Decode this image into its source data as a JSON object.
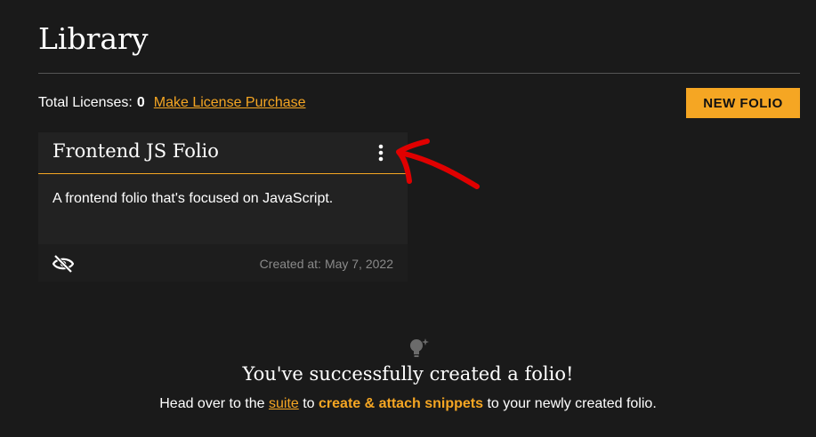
{
  "page": {
    "title": "Library"
  },
  "licenses": {
    "label": "Total Licenses:",
    "count": "0",
    "purchase_link": "Make License Purchase"
  },
  "toolbar": {
    "new_folio_label": "NEW FOLIO"
  },
  "folio_card": {
    "title": "Frontend JS Folio",
    "description": "A frontend folio that's focused on JavaScript.",
    "created_label": "Created at:",
    "created_date": "May 7, 2022",
    "visibility_icon": "eye-off-icon",
    "menu_icon": "kebab-menu-icon"
  },
  "success": {
    "title": "You've successfully created a folio!",
    "line_prefix": "Head over to the",
    "suite_link": "suite",
    "line_mid": "to",
    "action": "create & attach snippets",
    "line_suffix": "to your newly created folio."
  },
  "colors": {
    "accent": "#f5a623",
    "background": "#1a1a1a",
    "card": "#222222",
    "annotation": "#e00000"
  }
}
